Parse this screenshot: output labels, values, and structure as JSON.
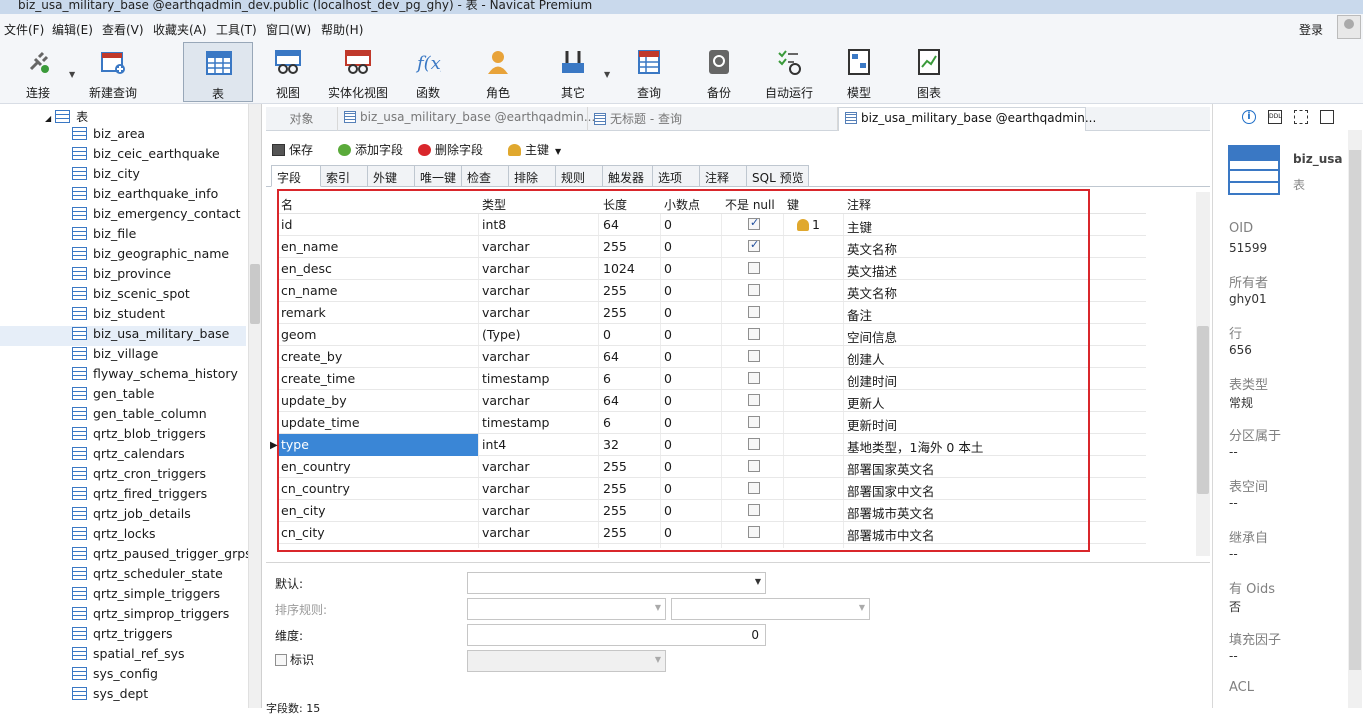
{
  "window": {
    "title": "biz_usa_military_base @earthqadmin_dev.public (localhost_dev_pg_ghy) - 表 - Navicat Premium"
  },
  "menu": {
    "items": [
      "文件(F)",
      "编辑(E)",
      "查看(V)",
      "收藏夹(A)",
      "工具(T)",
      "窗口(W)",
      "帮助(H)"
    ],
    "login": "登录"
  },
  "toolbar": {
    "items": [
      "连接",
      "新建查询",
      "表",
      "视图",
      "实体化视图",
      "函数",
      "角色",
      "其它",
      "查询",
      "备份",
      "自动运行",
      "模型",
      "图表"
    ]
  },
  "sidebar": {
    "root": "表",
    "items": [
      "biz_area",
      "biz_ceic_earthquake",
      "biz_city",
      "biz_earthquake_info",
      "biz_emergency_contact",
      "biz_file",
      "biz_geographic_name",
      "biz_province",
      "biz_scenic_spot",
      "biz_student",
      "biz_usa_military_base",
      "biz_village",
      "flyway_schema_history",
      "gen_table",
      "gen_table_column",
      "qrtz_blob_triggers",
      "qrtz_calendars",
      "qrtz_cron_triggers",
      "qrtz_fired_triggers",
      "qrtz_job_details",
      "qrtz_locks",
      "qrtz_paused_trigger_grps",
      "qrtz_scheduler_state",
      "qrtz_simple_triggers",
      "qrtz_simprop_triggers",
      "qrtz_triggers",
      "spatial_ref_sys",
      "sys_config",
      "sys_dept"
    ],
    "selected": "biz_usa_military_base"
  },
  "tabs": {
    "objects": "对象",
    "tab1": "biz_usa_military_base @earthqadmin...",
    "tab2": "无标题 - 查询",
    "tab3": "biz_usa_military_base @earthqadmin..."
  },
  "subtoolbar": {
    "save": "保存",
    "add_field": "添加字段",
    "delete_field": "删除字段",
    "primary_key": "主键"
  },
  "innertabs": [
    "字段",
    "索引",
    "外键",
    "唯一键",
    "检查",
    "排除",
    "规则",
    "触发器",
    "选项",
    "注释",
    "SQL 预览"
  ],
  "grid": {
    "columns": [
      "名",
      "类型",
      "长度",
      "小数点",
      "不是 null",
      "键",
      "注释"
    ],
    "rows": [
      {
        "name": "id",
        "type": "int8",
        "length": "64",
        "decimal": "0",
        "notnull": true,
        "key": "1",
        "comment": "主键"
      },
      {
        "name": "en_name",
        "type": "varchar",
        "length": "255",
        "decimal": "0",
        "notnull": true,
        "key": "",
        "comment": "英文名称"
      },
      {
        "name": "en_desc",
        "type": "varchar",
        "length": "1024",
        "decimal": "0",
        "notnull": false,
        "key": "",
        "comment": "英文描述"
      },
      {
        "name": "cn_name",
        "type": "varchar",
        "length": "255",
        "decimal": "0",
        "notnull": false,
        "key": "",
        "comment": "英文名称"
      },
      {
        "name": "remark",
        "type": "varchar",
        "length": "255",
        "decimal": "0",
        "notnull": false,
        "key": "",
        "comment": "备注"
      },
      {
        "name": "geom",
        "type": "(Type)",
        "length": "0",
        "decimal": "0",
        "notnull": false,
        "key": "",
        "comment": "空间信息"
      },
      {
        "name": "create_by",
        "type": "varchar",
        "length": "64",
        "decimal": "0",
        "notnull": false,
        "key": "",
        "comment": "创建人"
      },
      {
        "name": "create_time",
        "type": "timestamp",
        "length": "6",
        "decimal": "0",
        "notnull": false,
        "key": "",
        "comment": "创建时间"
      },
      {
        "name": "update_by",
        "type": "varchar",
        "length": "64",
        "decimal": "0",
        "notnull": false,
        "key": "",
        "comment": "更新人"
      },
      {
        "name": "update_time",
        "type": "timestamp",
        "length": "6",
        "decimal": "0",
        "notnull": false,
        "key": "",
        "comment": "更新时间"
      },
      {
        "name": "type",
        "type": "int4",
        "length": "32",
        "decimal": "0",
        "notnull": false,
        "key": "",
        "comment": "基地类型，1海外 0 本土"
      },
      {
        "name": "en_country",
        "type": "varchar",
        "length": "255",
        "decimal": "0",
        "notnull": false,
        "key": "",
        "comment": "部署国家英文名"
      },
      {
        "name": "cn_country",
        "type": "varchar",
        "length": "255",
        "decimal": "0",
        "notnull": false,
        "key": "",
        "comment": "部署国家中文名"
      },
      {
        "name": "en_city",
        "type": "varchar",
        "length": "255",
        "decimal": "0",
        "notnull": false,
        "key": "",
        "comment": "部署城市英文名"
      },
      {
        "name": "cn_city",
        "type": "varchar",
        "length": "255",
        "decimal": "0",
        "notnull": false,
        "key": "",
        "comment": "部署城市中文名"
      }
    ],
    "selected_row": "type"
  },
  "props": {
    "default_label": "默认:",
    "collation_label": "排序规则:",
    "dimension_label": "维度:",
    "dimension_value": "0",
    "identity_label": "标识"
  },
  "status": {
    "field_count": "字段数: 15"
  },
  "rpanel": {
    "name": "biz_usa",
    "kind": "表",
    "fields": [
      {
        "label": "OID",
        "value": "51599"
      },
      {
        "label": "所有者",
        "value": "ghy01"
      },
      {
        "label": "行",
        "value": "656"
      },
      {
        "label": "表类型",
        "value": "常规"
      },
      {
        "label": "分区属于",
        "value": "--"
      },
      {
        "label": "表空间",
        "value": "--"
      },
      {
        "label": "继承自",
        "value": "--"
      },
      {
        "label": "有 Oids",
        "value": "否"
      },
      {
        "label": "填充因子",
        "value": "--"
      },
      {
        "label": "ACL",
        "value": ""
      }
    ]
  },
  "colors": {
    "accent": "#3a86d6",
    "highlight_box": "#d9262b",
    "icon_blue": "#3a78c4"
  }
}
